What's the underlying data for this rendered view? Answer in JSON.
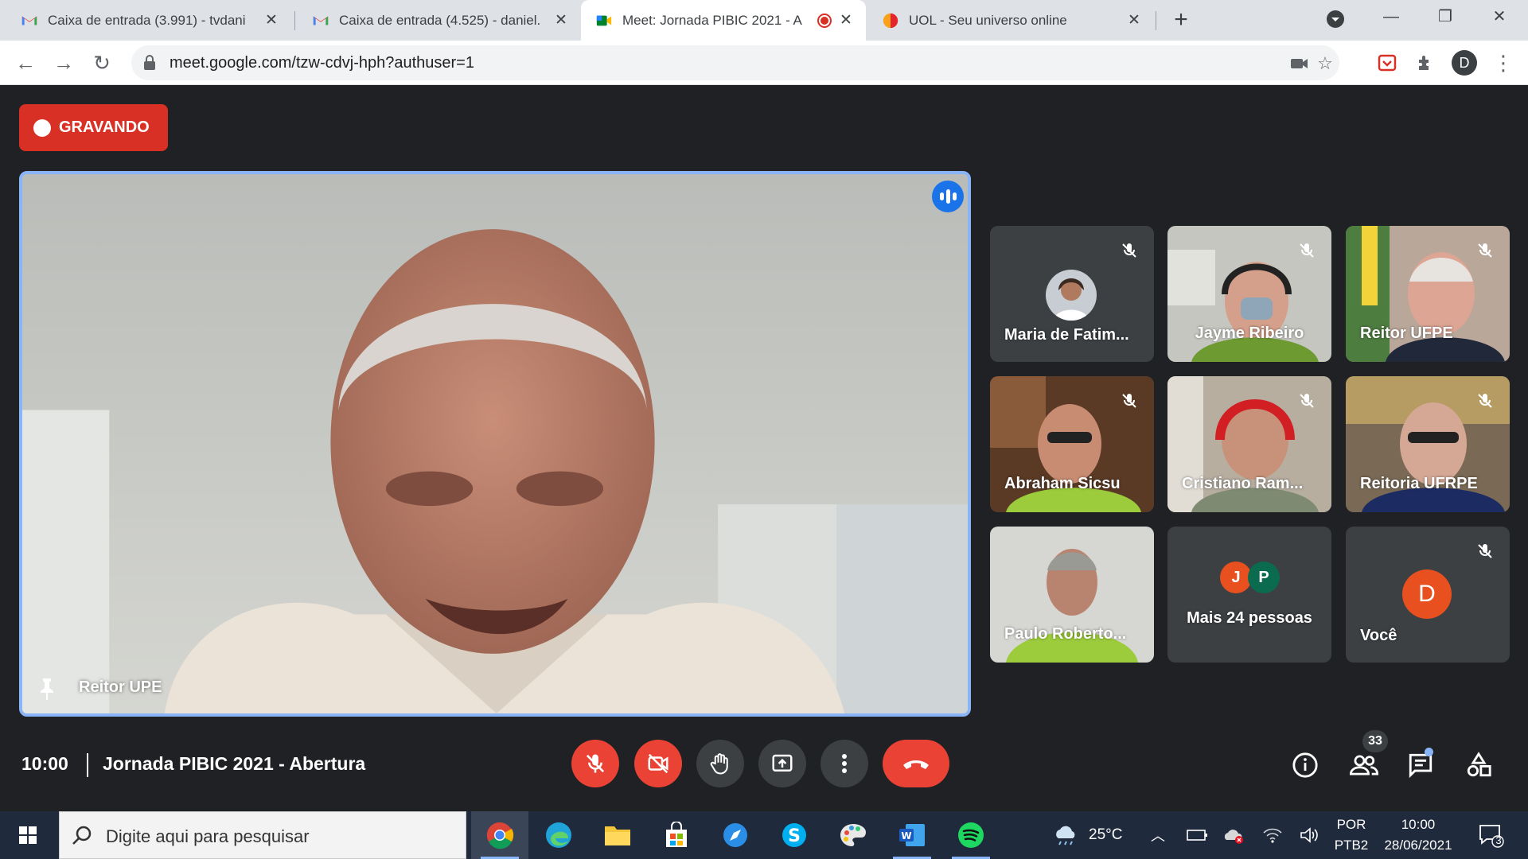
{
  "browser": {
    "tabs": [
      {
        "title": "Caixa de entrada (3.991) - tvdani",
        "icon": "gmail-icon"
      },
      {
        "title": "Caixa de entrada (4.525) - daniel.",
        "icon": "gmail-icon"
      },
      {
        "title": "Meet: Jornada PIBIC 2021 - A",
        "icon": "meet-icon",
        "active": true
      },
      {
        "title": "UOL - Seu universo online",
        "icon": "uol-icon"
      }
    ],
    "url": "meet.google.com/tzw-cdvj-hph?authuser=1",
    "profile_initial": "D"
  },
  "recording": {
    "label": "GRAVANDO",
    "color": "#d93025"
  },
  "main_speaker": {
    "name": "Reitor UPE"
  },
  "participants": [
    {
      "name": "Maria de Fatim...",
      "type": "avatar",
      "muted": true
    },
    {
      "name": "Jayme Ribeiro",
      "type": "video",
      "muted": true
    },
    {
      "name": "Reitor UFPE",
      "type": "video",
      "muted": true
    },
    {
      "name": "Abraham Sicsu",
      "type": "video",
      "muted": true
    },
    {
      "name": "Cristiano Ram...",
      "type": "video",
      "muted": true
    },
    {
      "name": "Reitoria UFRPE",
      "type": "video",
      "muted": true
    },
    {
      "name": "Paulo Roberto...",
      "type": "video",
      "muted": false
    },
    {
      "name": "Mais 24 pessoas",
      "type": "more",
      "initials": [
        "J",
        "P"
      ]
    },
    {
      "name": "Você",
      "type": "self",
      "initial": "D",
      "muted": true
    }
  ],
  "meeting": {
    "time": "10:00",
    "title": "Jornada PIBIC 2021 - Abertura",
    "people_count": "33"
  },
  "taskbar": {
    "search_placeholder": "Digite aqui para pesquisar",
    "weather": "25°C",
    "language_top": "POR",
    "language_bottom": "PTB2",
    "clock_time": "10:00",
    "clock_date": "28/06/2021",
    "notification_count": "3"
  }
}
